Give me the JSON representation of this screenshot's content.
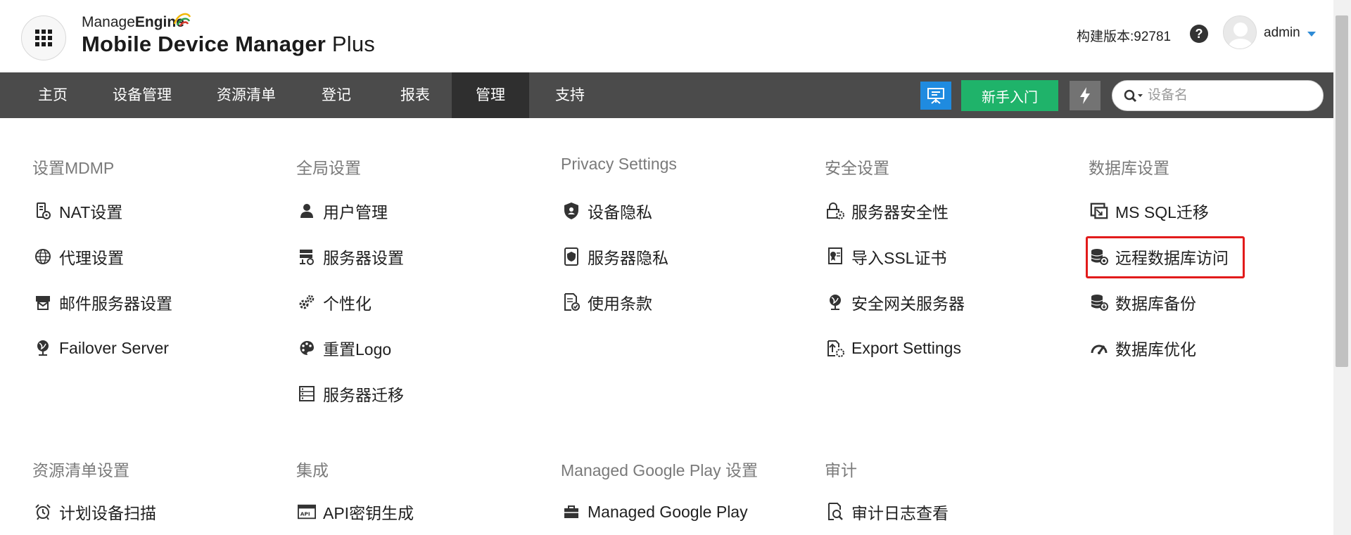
{
  "brand": {
    "company_prefix": "Manage",
    "company_suffix": "Engine",
    "product_main": "Mobile Device Manager",
    "product_suffix": "Plus"
  },
  "header": {
    "build_label": "构建版本:92781",
    "help_symbol": "?",
    "user_name": "admin"
  },
  "nav": {
    "items": [
      "主页",
      "设备管理",
      "资源清单",
      "登记",
      "报表",
      "管理",
      "支持"
    ],
    "active": "管理"
  },
  "toolbar": {
    "getting_started_label": "新手入门"
  },
  "search": {
    "placeholder": "设备名"
  },
  "colors": {
    "nav_bg": "#4b4b4b",
    "nav_active": "#2f2f2f",
    "blue_button": "#1f8be0",
    "green_button": "#1fb36a",
    "highlight": "#e21b1b"
  },
  "sections": [
    {
      "title": "设置MDMP",
      "items": [
        {
          "label": "NAT设置",
          "icon": "nat-server-icon"
        },
        {
          "label": "代理设置",
          "icon": "globe-icon"
        },
        {
          "label": "邮件服务器设置",
          "icon": "mail-server-icon"
        },
        {
          "label": "Failover Server",
          "icon": "failover-globe-icon"
        }
      ]
    },
    {
      "title": "全局设置",
      "items": [
        {
          "label": "用户管理",
          "icon": "user-icon"
        },
        {
          "label": "服务器设置",
          "icon": "server-settings-icon"
        },
        {
          "label": "个性化",
          "icon": "gears-icon"
        },
        {
          "label": "重置Logo",
          "icon": "palette-icon"
        },
        {
          "label": "服务器迁移",
          "icon": "server-migration-icon"
        }
      ]
    },
    {
      "title": "Privacy Settings",
      "items": [
        {
          "label": "设备隐私",
          "icon": "shield-icon"
        },
        {
          "label": "服务器隐私",
          "icon": "server-privacy-icon"
        },
        {
          "label": "使用条款",
          "icon": "terms-icon"
        }
      ]
    },
    {
      "title": "安全设置",
      "items": [
        {
          "label": "服务器安全性",
          "icon": "lock-gear-icon"
        },
        {
          "label": "导入SSL证书",
          "icon": "certificate-icon"
        },
        {
          "label": "安全网关服务器",
          "icon": "gateway-globe-icon"
        },
        {
          "label": "Export Settings",
          "icon": "export-icon"
        }
      ]
    },
    {
      "title": "数据库设置",
      "items": [
        {
          "label": "MS SQL迁移",
          "icon": "sql-migration-icon"
        },
        {
          "label": "远程数据库访问",
          "icon": "remote-database-icon"
        },
        {
          "label": "数据库备份",
          "icon": "database-backup-icon"
        },
        {
          "label": "数据库优化",
          "icon": "speedometer-icon"
        }
      ]
    },
    {
      "title": "资源清单设置",
      "items": [
        {
          "label": "计划设备扫描",
          "icon": "alarm-clock-icon"
        }
      ]
    },
    {
      "title": "集成",
      "items": [
        {
          "label": "API密钥生成",
          "icon": "api-icon"
        }
      ]
    },
    {
      "title": "Managed Google Play 设置",
      "items": [
        {
          "label": "Managed Google Play",
          "icon": "briefcase-icon"
        }
      ]
    },
    {
      "title": "审计",
      "items": [
        {
          "label": "审计日志查看",
          "icon": "audit-search-icon"
        }
      ]
    }
  ],
  "highlighted_item": "远程数据库访问"
}
